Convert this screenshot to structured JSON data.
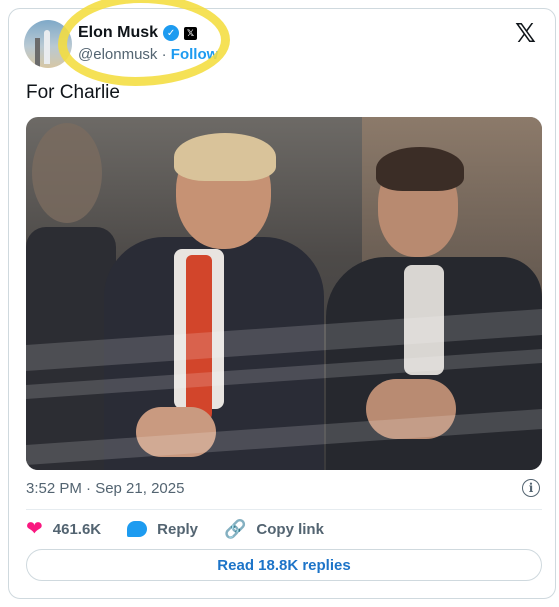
{
  "author": {
    "name": "Elon Musk",
    "handle": "@elonmusk",
    "separator": "·",
    "follow_label": "Follow",
    "verified_glyph": "✓",
    "x_badge_glyph": "𝕏"
  },
  "x_logo": "𝕏",
  "tweet": {
    "text": "For Charlie",
    "timestamp": "3:52 PM · Sep 21, 2025"
  },
  "info_glyph": "i",
  "actions": {
    "likes_count": "461.6K",
    "heart_glyph": "❤",
    "reply_label": "Reply",
    "link_glyph": "🔗",
    "copy_link_label": "Copy link"
  },
  "read_replies_label": "Read 18.8K replies",
  "colors": {
    "accent": "#1d9bf0",
    "like": "#f91880",
    "highlight": "#f4dd3f",
    "tie": "#d2452b"
  },
  "icons": [
    "verified-badge-icon",
    "x-badge-icon",
    "x-logo-icon",
    "info-icon",
    "heart-icon",
    "reply-icon",
    "copy-link-icon"
  ]
}
